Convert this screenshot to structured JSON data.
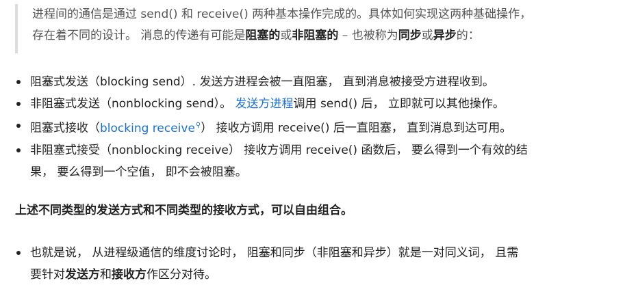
{
  "quote": {
    "line1": "进程间的通信是通过 send() 和 receive() 两种基本操作完成的。具体如何实现这两种基础操作，",
    "line2_a": "存在着不同的设计。 消息的传递有可能是",
    "bold_blocking": "阻塞的",
    "or1": "或",
    "bold_nonblocking": "非阻塞的",
    "mid": " – 也被称为",
    "bold_sync": "同步",
    "or2": "或",
    "bold_async": "异步",
    "end": "的："
  },
  "bullets": [
    {
      "text": "阻塞式发送（blocking send）. 发送方进程会被一直阻塞， 直到消息被接受方进程收到。"
    },
    {
      "prefix": "非阻塞式发送（nonblocking send）。 ",
      "link": "发送方进程",
      "suffix": "调用 send() 后， 立即就可以其他操作。"
    },
    {
      "prefix": "阻塞式接收（",
      "link": "blocking receive",
      "suffix": "） 接收方调用 receive() 后一直阻塞， 直到消息到达可用。"
    },
    {
      "line1": "非阻塞式接受（nonblocking receive） 接收方调用 receive() 函数后， 要么得到一个有效的结",
      "line2": "果， 要么得到一个空值， 即不会被阻塞。"
    }
  ],
  "heading": "上述不同类型的发送方式和不同类型的接收方式，可以自由组合。",
  "bullet_last": {
    "line1": "也就是说， 从进程级通信的维度讨论时， 阻塞和同步（非阻塞和异步）就是一对同义词， 且需",
    "line2_a": "要针对",
    "bold_send": "发送方",
    "and": "和",
    "bold_recv": "接收方",
    "line2_end": "作区分对待。"
  },
  "colors": {
    "link": "#1a6fd6",
    "quote_text": "#555555",
    "quote_border": "#dcdcdc",
    "text": "#222222"
  },
  "icons": {
    "link_search": "search-icon"
  }
}
